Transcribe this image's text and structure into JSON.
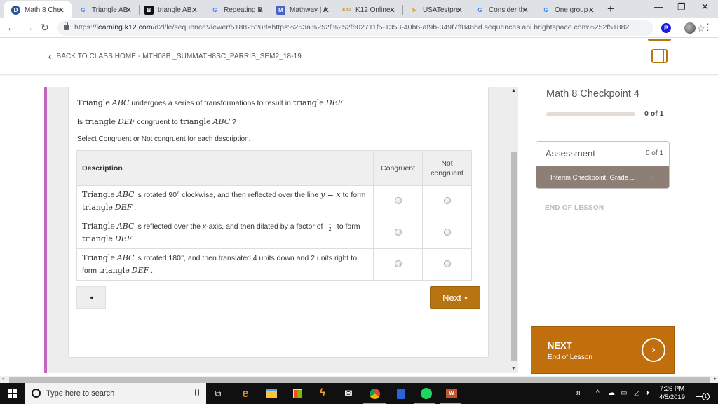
{
  "browser": {
    "tabs": [
      {
        "title": "Math 8 Che",
        "icon": "d2l-icon",
        "active": true
      },
      {
        "title": "Triangle AB",
        "icon": "google-icon",
        "active": false
      },
      {
        "title": "triangle AB",
        "icon": "brainly-icon",
        "active": false
      },
      {
        "title": "Repeating D",
        "icon": "google-icon",
        "active": false
      },
      {
        "title": "Mathway | A",
        "icon": "mathway-icon",
        "active": false
      },
      {
        "title": "K12 Online",
        "icon": "k12-icon",
        "active": false
      },
      {
        "title": "USATestpre",
        "icon": "usatestprep-icon",
        "active": false
      },
      {
        "title": "Consider th",
        "icon": "google-icon",
        "active": false
      },
      {
        "title": "One group",
        "icon": "google-icon",
        "active": false
      }
    ],
    "new_tab": "+",
    "window_controls": {
      "minimize": "—",
      "restore": "❐",
      "close": "✕"
    },
    "url_prefix": "https://",
    "url_host": "learning.k12.com",
    "url_rest": "/d2l/le/sequenceViewer/518825?url=https%253a%252f%252fe02711f5-1353-40b6-af9b-349f7ff846bd.sequences.api.brightspace.com%252f51882..."
  },
  "header": {
    "back_link": "BACK TO CLASS HOME - MTH08B _SUMMATH8SC_PARRIS_SEM2_18-19"
  },
  "question": {
    "intro": {
      "t1": "Triangle",
      "v1": "ABC",
      "t2": " undergoes a series of transformations to result in ",
      "t3": "triangle",
      "v2": "DEF",
      "t4": " ."
    },
    "prompt": {
      "t1": "Is ",
      "t2": "triangle",
      "v1": "DEF",
      "t3": " congruent to ",
      "t4": "triangle",
      "v2": "ABC",
      "t5": " ?"
    },
    "instruction": "Select Congruent or Not congruent for each description.",
    "table": {
      "headers": {
        "description": "Description",
        "congruent": "Congruent",
        "not_congruent_1": "Not",
        "not_congruent_2": "congruent"
      },
      "rows": [
        {
          "a": "Triangle",
          "v1": "ABC",
          "b": " is rotated 90° clockwise, and then reflected over the line ",
          "eq": "y = x",
          "c": " to form",
          "d": "triangle",
          "v2": "DEF",
          "e": " .",
          "congruent": false,
          "not_congruent": false
        },
        {
          "a": "Triangle",
          "v1": "ABC",
          "b": " is reflected over the ",
          "xi": "x",
          "b2": "-axis, and then dilated by a factor of ",
          "frac_num": "1",
          "frac_den": "2",
          "c": " to form",
          "d": "triangle",
          "v2": "DEF",
          "e": " .",
          "congruent": false,
          "not_congruent": false
        },
        {
          "a": "Triangle",
          "v1": "ABC",
          "b": " is rotated 180°, and then translated 4 units down and 2 units right to",
          "c0": "form ",
          "d": "triangle",
          "v2": "DEF",
          "e": " .",
          "congruent": false,
          "not_congruent": false
        }
      ]
    },
    "prev_label": "◂",
    "next_label": "Next",
    "next_arrow": "▸"
  },
  "sidebar": {
    "title": "Math 8 Checkpoint 4",
    "progress_fraction": 0,
    "progress_text": "0 of 1",
    "assessment": {
      "heading": "Assessment",
      "count": "0 of 1",
      "item": "Interim Checkpoint: Grade ...",
      "item_marker": "•"
    },
    "end_of_lesson": "END OF LESSON",
    "next": {
      "title": "NEXT",
      "subtitle": "End of Lesson",
      "arrow": "›"
    }
  },
  "taskbar": {
    "search_placeholder": "Type here to search",
    "time": "7:26 PM",
    "date": "4/5/2019",
    "notification_count": "1"
  },
  "colors": {
    "accent": "#b8760f",
    "purple_bar": "#c665c0",
    "assessment_item_bg": "#8d7e76",
    "next_lesson_bg": "#c06f0c"
  }
}
